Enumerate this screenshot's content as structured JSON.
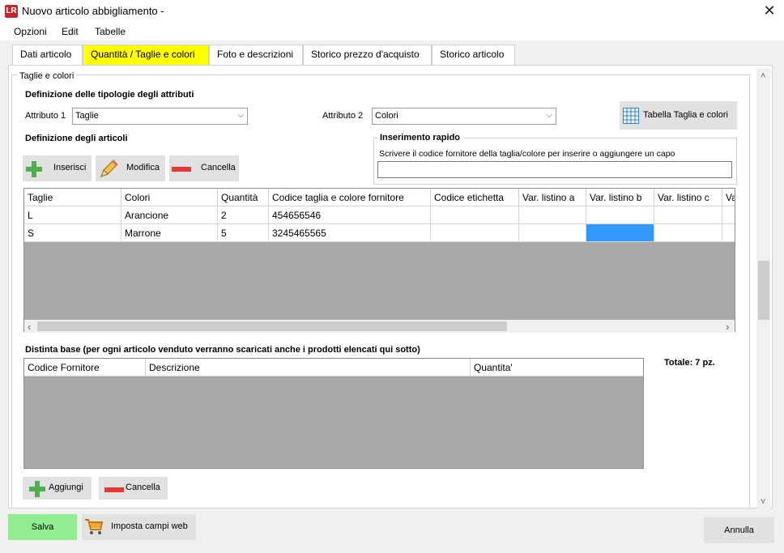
{
  "window": {
    "app_icon": "LR",
    "title": "Nuovo articolo abbigliamento -",
    "close_glyph": "✕"
  },
  "menu": [
    "Opzioni",
    "Edit",
    "Tabelle"
  ],
  "tabs": [
    {
      "label": "Dati articolo"
    },
    {
      "label": "Quantità / Taglie e colori"
    },
    {
      "label": "Foto e descrizioni"
    },
    {
      "label": "Storico prezzo d'acquisto"
    },
    {
      "label": "Storico articolo"
    }
  ],
  "section": {
    "group_title": "Taglie e colori",
    "attr_def_title": "Definizione delle tipologie degli attributi",
    "attr1_label": "Attributo 1",
    "attr1_value": "Taglie",
    "attr2_label": "Attributo 2",
    "attr2_value": "Colori",
    "table_button": "Tabella Taglia e colori",
    "articles_title": "Definizione degli articoli",
    "quick_title": "Inserimento rapido",
    "quick_hint": "Scrivere il codice fornitore della taglia/colore per inserire o aggiungere un capo",
    "quick_value": "",
    "btn_insert": "Inserisci",
    "btn_edit": "Modifica",
    "btn_delete": "Cancella"
  },
  "articles_table": {
    "columns": [
      "Taglie",
      "Colori",
      "Quantità",
      "Codice taglia e colore fornitore",
      "Codice etichetta",
      "Var. listino a",
      "Var. listino b",
      "Var. listino c",
      "Va"
    ],
    "rows": [
      [
        "L",
        "Arancione",
        "2",
        "454656546",
        "",
        "",
        "",
        "",
        ""
      ],
      [
        "S",
        "Marrone",
        "5",
        "3245465565",
        "",
        "",
        "",
        "",
        ""
      ]
    ],
    "selected_color": "#3399ff"
  },
  "bom": {
    "title": "Distinta base (per ogni articolo venduto verranno scaricati anche i prodotti elencati qui sotto)",
    "total": "Totale: 7 pz.",
    "columns": [
      "Codice Fornitore",
      "Descrizione",
      "Quantita'"
    ],
    "btn_add": "Aggiungi",
    "btn_delete": "Cancella"
  },
  "footer": {
    "save": "Salva",
    "web": "Imposta campi web",
    "cancel": "Annulla"
  },
  "scroll": {
    "left": "‹",
    "right": "›",
    "up": "˄",
    "down": "˅"
  },
  "colors": {
    "active_tab": "#ffff00",
    "save_button": "#90ee90",
    "grid_empty": "#a9a9a9"
  }
}
